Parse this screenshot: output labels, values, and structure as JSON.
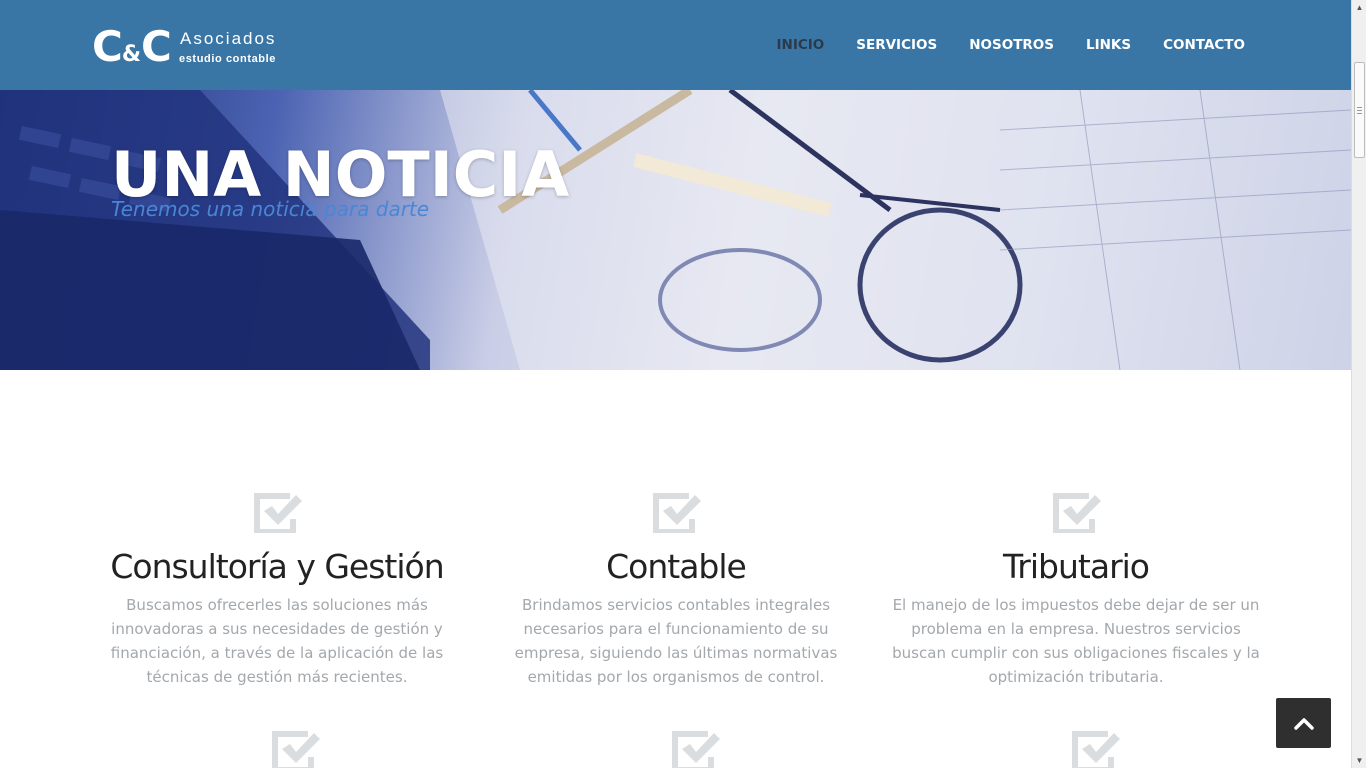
{
  "brand": {
    "mark_c1": "C",
    "mark_amp": "&",
    "mark_c2": "C",
    "title": "Asociados",
    "subtitle": "estudio contable"
  },
  "nav": {
    "items": [
      {
        "label": "INICIO",
        "active": true
      },
      {
        "label": "SERVICIOS",
        "active": false
      },
      {
        "label": "NOSOTROS",
        "active": false
      },
      {
        "label": "LINKS",
        "active": false
      },
      {
        "label": "CONTACTO",
        "active": false
      }
    ]
  },
  "hero": {
    "title": "UNA NOTICIA",
    "subtitle": "Tenemos una noticia para darte"
  },
  "services": [
    {
      "icon": "checkbox-check-icon",
      "title": "Consultoría y Gestión",
      "text": "Buscamos ofrecerles las soluciones más innovadoras a sus necesidades de gestión y financiación, a través de la aplicación de las técnicas de gestión más recientes."
    },
    {
      "icon": "checkbox-check-icon",
      "title": "Contable",
      "text": "Brindamos servicios contables integrales necesarios para el funcionamiento de su empresa, siguiendo las últimas normativas emitidas por los organismos de control."
    },
    {
      "icon": "checkbox-check-icon",
      "title": "Tributario",
      "text": "El manejo de los impuestos debe dejar de ser un problema en la empresa. Nuestros servicios buscan cumplir con sus obligaciones fiscales y la optimización tributaria."
    }
  ],
  "back_to_top": {
    "icon": "chevron-up-icon"
  },
  "colors": {
    "header_bg": "#3a76a5",
    "nav_active": "#2b3a4a",
    "hero_subtitle": "#4a86d6",
    "body_text": "#a3a8ad",
    "icon": "#dadde0"
  }
}
